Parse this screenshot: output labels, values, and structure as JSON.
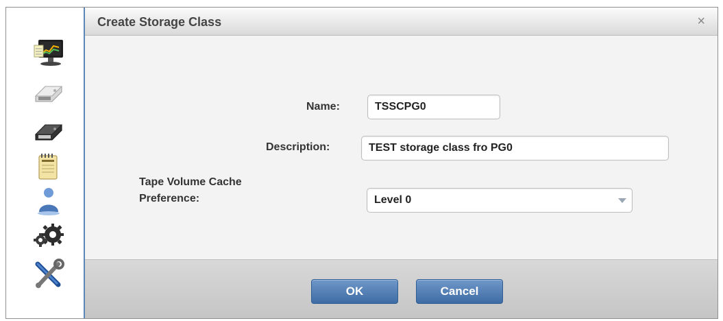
{
  "dialog": {
    "title": "Create Storage Class",
    "close_glyph": "×"
  },
  "form": {
    "name_label": "Name:",
    "name_value": "TSSCPG0",
    "description_label": "Description:",
    "description_value": "TEST storage class fro PG0",
    "cache_label_line1": "Tape Volume Cache",
    "cache_label_line2": "Preference:",
    "cache_value": "Level 0"
  },
  "buttons": {
    "ok_label": "OK",
    "cancel_label": "Cancel"
  },
  "sidebar": {
    "icons": [
      "monitoring-icon",
      "system-icon",
      "cluster-icon",
      "volume-icon",
      "user-icon",
      "settings-gears-icon",
      "tools-icon"
    ]
  },
  "colors": {
    "accent": "#4a78b0",
    "dialog_border": "#5b86b7"
  }
}
